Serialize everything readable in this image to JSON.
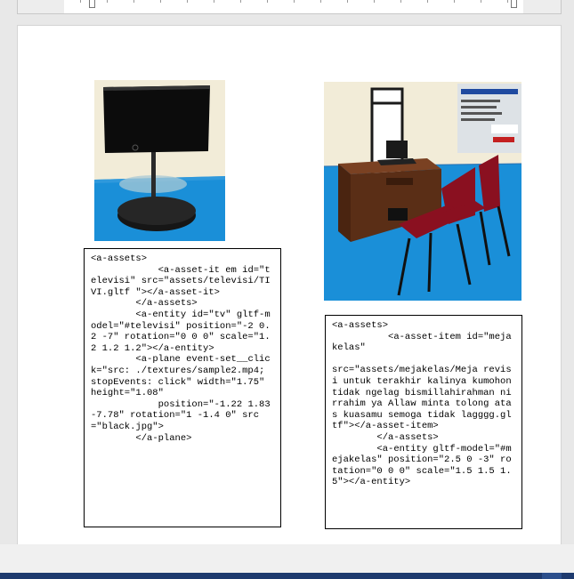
{
  "document": {
    "left_code": "<a-assets>\n            <a-asset-it em id=\"televisi\" src=\"assets/televisi/TIVI.gltf \"></a-asset-it>\n        </a-assets>\n        <a-entity id=\"tv\" gltf-model=\"#televisi\" position=\"-2 0.2 -7\" rotation=\"0 0 0\" scale=\"1.2 1.2 1.2\"></a-entity>\n        <a-plane event-set__click=\"src: ./textures/sample2.mp4; stopEvents: click\" width=\"1.75\" height=\"1.08\"\n            position=\"-1.22 1.83 -7.78\" rotation=\"1 -1.4 0\" src=\"black.jpg\">\n        </a-plane>",
    "right_code": "<a-assets>\n          <a-asset-item id=\"mejakelas\"\n\nsrc=\"assets/mejakelas/Meja revisi untuk terakhir kalinya kumohon tidak ngelag bismillahirahman nirrahim ya Allaw minta tolong atas kuasamu semoga tidak lagggg.gltf\"></a-asset-item>\n        </a-assets>\n        <a-entity gltf-model=\"#mejakelas\" position=\"2.5 0 -3\" rotation=\"0 0 0\" scale=\"1.5 1.5 1.5\"></a-entity>"
  },
  "images": {
    "tv": "television-on-stand-render",
    "desk": "classroom-desk-and-chairs-render"
  },
  "colors": {
    "floor_blue": "#1a8fd8",
    "wall_cream": "#f2ecd8",
    "chair_red": "#8a1020",
    "desk_brown": "#5a2e16",
    "taskbar": "#1e3a6e"
  }
}
